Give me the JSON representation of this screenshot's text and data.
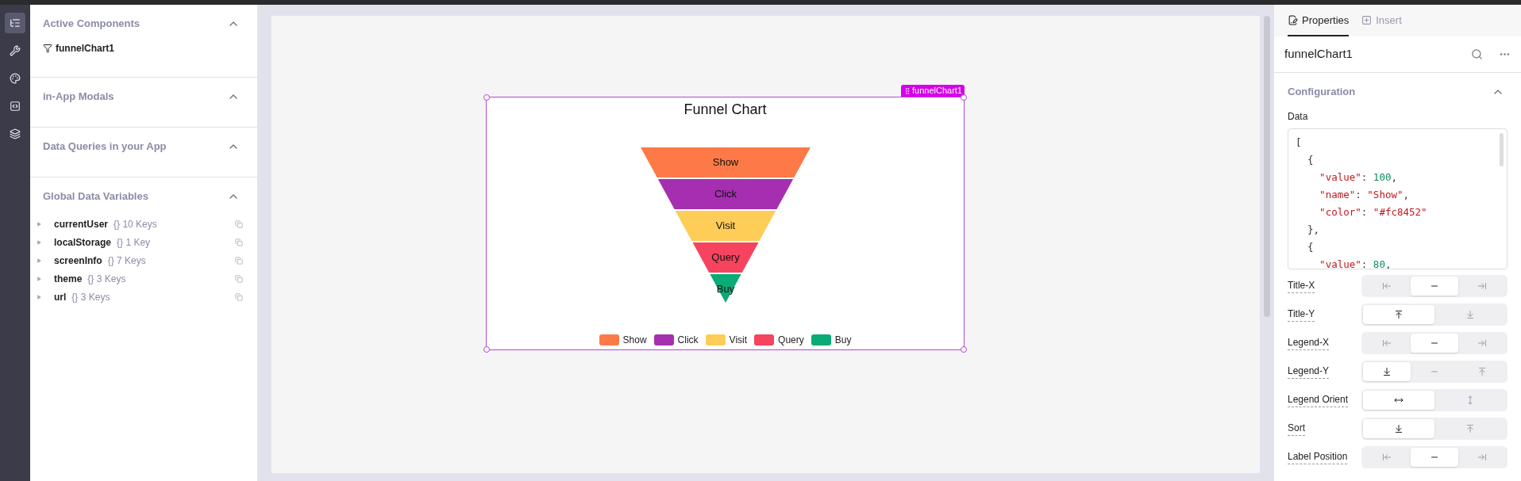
{
  "sidebar_rail": [
    {
      "kind": "tree",
      "selected": true
    },
    {
      "kind": "tools",
      "selected": false
    },
    {
      "kind": "palette",
      "selected": false
    },
    {
      "kind": "code",
      "selected": false
    },
    {
      "kind": "layers",
      "selected": false
    }
  ],
  "left_panel": {
    "sections": [
      {
        "title": "Active Components",
        "expanded": true,
        "items": [
          {
            "label": "funnelChart1"
          }
        ]
      },
      {
        "title": "in-App Modals",
        "expanded": true
      },
      {
        "title": "Data Queries in your App",
        "expanded": true
      },
      {
        "title": "Global Data Variables",
        "expanded": true,
        "variables": [
          {
            "name": "currentUser",
            "summary": "{} 10 Keys"
          },
          {
            "name": "localStorage",
            "summary": "{} 1 Key"
          },
          {
            "name": "screenInfo",
            "summary": "{} 7 Keys"
          },
          {
            "name": "theme",
            "summary": "{} 3 Keys"
          },
          {
            "name": "url",
            "summary": "{} 3 Keys"
          }
        ]
      }
    ]
  },
  "canvas": {
    "widget_tag": "funnelChart1",
    "chart": {
      "title": "Funnel Chart",
      "segments": [
        {
          "label": "Show",
          "color": "#fd7a48"
        },
        {
          "label": "Click",
          "color": "#a52fb0"
        },
        {
          "label": "Visit",
          "color": "#fdcd58"
        },
        {
          "label": "Query",
          "color": "#f6435e"
        },
        {
          "label": "Buy",
          "color": "#0aab74"
        }
      ],
      "legend": [
        {
          "label": "Show",
          "color": "#fd7a48"
        },
        {
          "label": "Click",
          "color": "#a52fb0"
        },
        {
          "label": "Visit",
          "color": "#fdcd58"
        },
        {
          "label": "Query",
          "color": "#f6435e"
        },
        {
          "label": "Buy",
          "color": "#0aab74"
        }
      ]
    }
  },
  "properties_panel": {
    "tabs": [
      {
        "label": "Properties",
        "selected": true
      },
      {
        "label": "Insert",
        "selected": false
      }
    ],
    "component_name": "funnelChart1",
    "section": {
      "title": "Configuration",
      "expanded": true
    },
    "data_label": "Data",
    "data_code": [
      "[",
      "  {",
      "    \"value\": 100,",
      "    \"name\": \"Show\",",
      "    \"color\": \"#fc8452\"",
      "  },",
      "  {",
      "    \"value\": 80,"
    ],
    "settings": [
      {
        "label": "Title-X",
        "options": [
          {
            "kind": "start",
            "selected": false
          },
          {
            "kind": "center",
            "selected": true
          },
          {
            "kind": "end",
            "selected": false
          }
        ]
      },
      {
        "label": "Title-Y",
        "options": [
          {
            "kind": "top",
            "selected": true
          },
          {
            "kind": "bottom",
            "selected": false
          }
        ]
      },
      {
        "label": "Legend-X",
        "options": [
          {
            "kind": "start",
            "selected": false
          },
          {
            "kind": "center",
            "selected": true
          },
          {
            "kind": "end",
            "selected": false
          }
        ]
      },
      {
        "label": "Legend-Y",
        "options": [
          {
            "kind": "bottom",
            "selected": true
          },
          {
            "kind": "center",
            "selected": false
          },
          {
            "kind": "top",
            "selected": false
          }
        ]
      },
      {
        "label": "Legend Orient",
        "options": [
          {
            "kind": "horizontal",
            "selected": true
          },
          {
            "kind": "vertical",
            "selected": false
          }
        ]
      },
      {
        "label": "Sort",
        "options": [
          {
            "kind": "bottom",
            "selected": true
          },
          {
            "kind": "top",
            "selected": false
          }
        ]
      },
      {
        "label": "Label Position",
        "options": [
          {
            "kind": "start",
            "selected": false
          },
          {
            "kind": "center",
            "selected": true
          },
          {
            "kind": "end",
            "selected": false
          }
        ]
      }
    ]
  }
}
